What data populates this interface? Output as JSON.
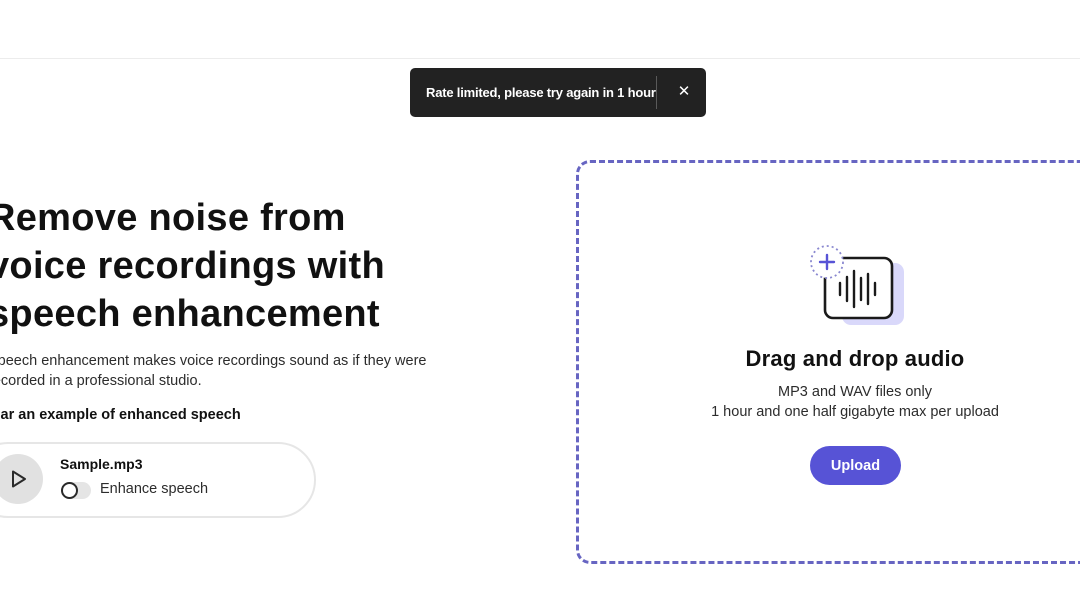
{
  "toast": {
    "message": "Rate limited, please try again in 1 hour",
    "close_symbol": "✕"
  },
  "hero": {
    "title_lines": [
      "Remove noise from",
      "voice recordings with",
      "speech enhancement"
    ],
    "description_lines": [
      "Speech enhancement makes voice recordings sound as if they were",
      "recorded in a professional studio."
    ],
    "example_label": "Hear an example of enhanced speech"
  },
  "player": {
    "file_name": "Sample.mp3",
    "toggle_label": "Enhance speech",
    "toggle_on": false,
    "play_icon": "play-icon"
  },
  "dropzone": {
    "title": "Drag and drop audio",
    "line1": "MP3 and WAV files only",
    "line2": "1 hour and one half gigabyte max per upload",
    "upload_label": "Upload",
    "icon": "audio-upload-icon"
  },
  "colors": {
    "accent": "#5753d6",
    "dropzone_border": "#6765c2",
    "toast_bg": "#222222",
    "icon_shadow": "#d9d8fa"
  }
}
